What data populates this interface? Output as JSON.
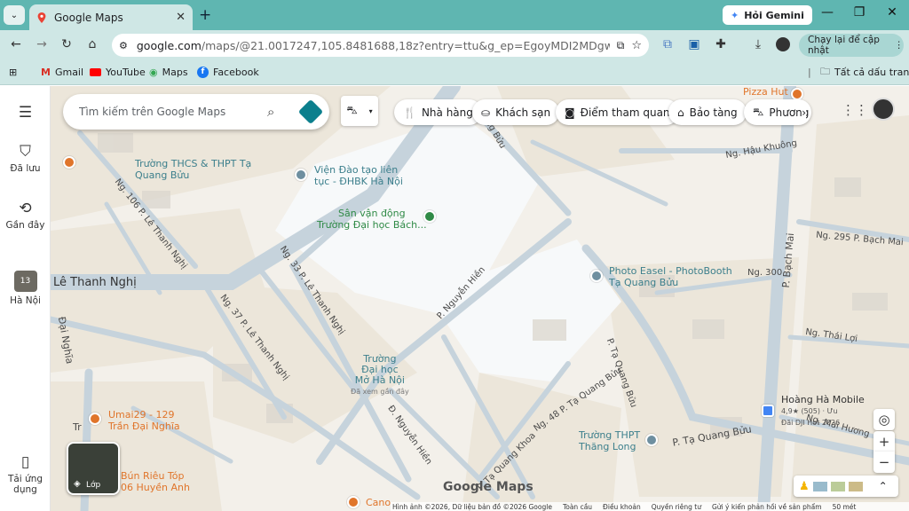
{
  "browser": {
    "tab_title": "Google Maps",
    "gemini_label": "Hỏi Gemini",
    "url_host": "google.com",
    "url_rest": "/maps/@21.0017247,105.8481688,18z?entry=ttu&g_ep=EgoyMDI2MDgwNS4xIKXMDSoA...",
    "update_label": "Chạy lại để cập nhật",
    "bookmarks": [
      "Gmail",
      "YouTube",
      "Maps",
      "Facebook"
    ],
    "all_bookmarks": "Tất cả dấu trang"
  },
  "sidebar": {
    "saved": "Đã lưu",
    "recent": "Gần đây",
    "place": "Hà Nội",
    "place_num": "13",
    "download": "Tải ứng dụng"
  },
  "search": {
    "placeholder": "Tìm kiếm trên Google Maps"
  },
  "chips": [
    "Nhà hàng",
    "Khách sạn",
    "Điểm tham quan",
    "Bảo tàng",
    "Phương"
  ],
  "labels": {
    "pizza": "Pizza Hut",
    "thcs": "Trường THCS & THPT Tạ Quang Bửu",
    "vien1": "Viện Đào tạo liên",
    "vien2": "tục - ĐHBK Hà Nội",
    "svd1": "Sân vận động",
    "svd2": "Trường Đại học Bách...",
    "photo1": "Photo Easel - PhotoBooth",
    "photo2": "Tạ Quang Bửu",
    "mo1": "Trường",
    "mo2": "Đại học",
    "mo3": "Mở Hà Nội",
    "mo4": "Đã xem gần đây",
    "umai1": "Umai29 - 129",
    "umai2": "Trần Đại Nghĩa",
    "hh1": "Hoàng Hà Mobile",
    "hh2": "4,9★ (505) · Ưu",
    "hh3": "Đãi DJI Hot 2026",
    "thpt1": "Trường THPT",
    "thpt2": "Thăng Long",
    "rieu1": "Bún Riêu Tóp",
    "rieu2": "06 Huyền Anh",
    "cano": "Cano",
    "le_thanh_nghi": "Lê Thanh Nghị",
    "quang_buu": "Quang Bửu",
    "le": "Lê",
    "ng106": "Ng. 106 P. Lê Thanh Nghị",
    "ng33": "Ng. 33 P. Lê Thanh Nghị",
    "ng37": "Ng. 37 P. Lê Thanh Nghị",
    "nguyen_hien": "P. Nguyễn Hiền",
    "ta_quang_buu": "P. Tạ Quang Bửu",
    "ta_quang_buu2": "P. Tạ Quang Bửu",
    "ng48": "Ng. 48 P. Tạ Quang Bửu",
    "bach_mai": "P. Bạch Mai",
    "hau_khuong": "Ng. Hậu Khuông",
    "ng295": "Ng. 295 P. Bạch Mai",
    "ng300": "Ng. 300",
    "thai_loi": "Ng. Thái Lợi",
    "mai_huong": "Ng. Mai Hương",
    "d_nguyen_hien": "Đ. Nguyễn Hiền",
    "khoa": "P. Tạ Quang Khoa",
    "dai_nghia": "Đại Nghĩa",
    "tr": "Tr"
  },
  "controls": {
    "layer": "Lớp",
    "logo": "Google Maps"
  },
  "footer": [
    "Hình ảnh ©2026, Dữ liệu bản đồ ©2026 Google",
    "Toàn cầu",
    "Điều khoản",
    "Quyền riêng tư",
    "Gửi ý kiến phản hồi về sản phẩm",
    "50 mét"
  ],
  "colors": {
    "tabbar": "#5fb6b1",
    "toolbar": "#cfe7e5",
    "map_bg": "#f3f0ea",
    "block": "#ede8de",
    "road": "#c6d3dc",
    "park": "#f6f8f9"
  }
}
